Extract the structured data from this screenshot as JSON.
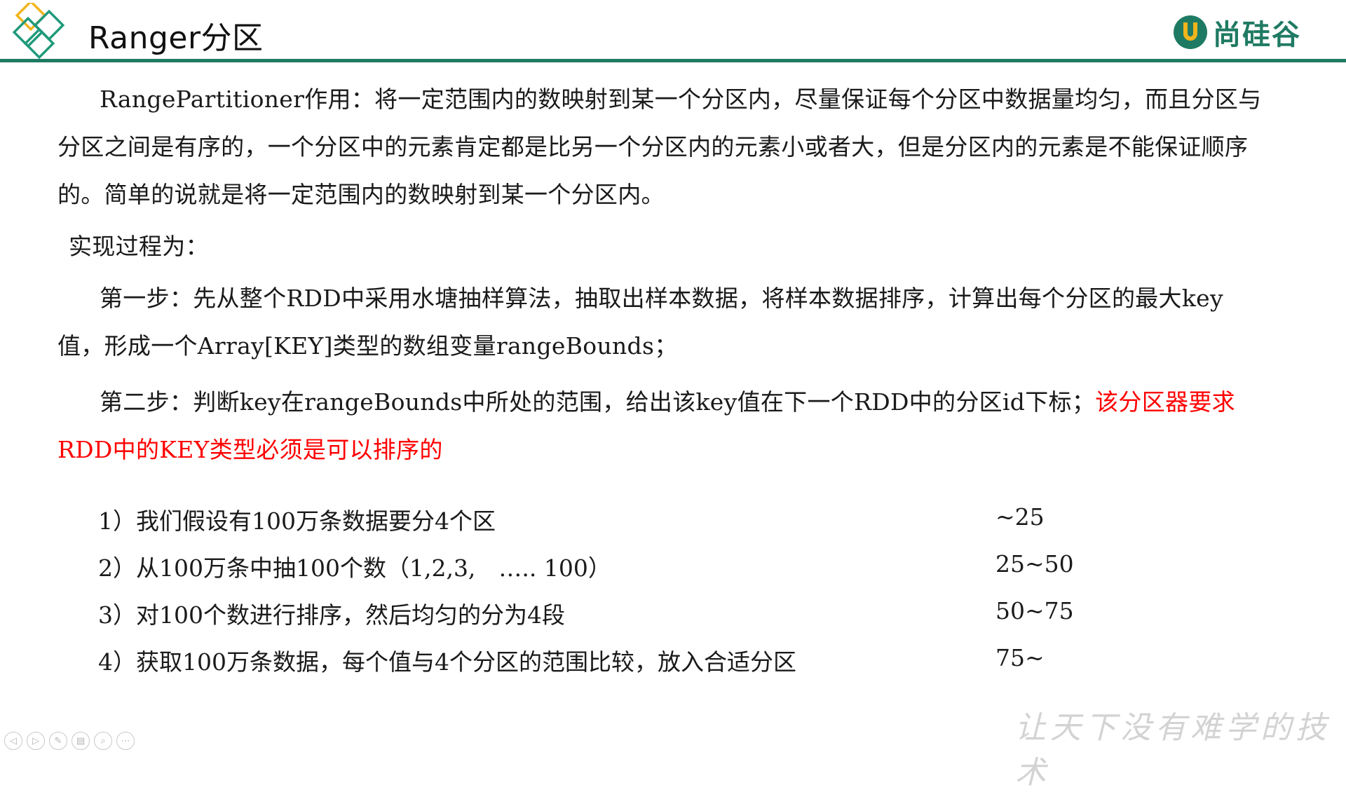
{
  "header": {
    "title": "Ranger分区",
    "brand_name": "尚硅谷",
    "accent_color": "#1f7a63"
  },
  "body": {
    "paragraph1": "RangePartitioner作用：将一定范围内的数映射到某一个分区内，尽量保证每个分区中数据量均匀，而且分区与分区之间是有序的，一个分区中的元素肯定都是比另一个分区内的元素小或者大，但是分区内的元素是不能保证顺序的。简单的说就是将一定范围内的数映射到某一个分区内。",
    "paragraph2": "实现过程为：",
    "step1": "第一步：先从整个RDD中采用水塘抽样算法，抽取出样本数据，将样本数据排序，计算出每个分区的最大key值，形成一个Array[KEY]类型的数组变量rangeBounds；",
    "step2_normal": "第二步：判断key在rangeBounds中所处的范围，给出该key值在下一个RDD中的分区id下标；",
    "step2_red": "该分区器要求RDD中的KEY类型必须是可以排序的",
    "highlight_color": "#ff0000"
  },
  "list": {
    "items": [
      "1）我们假设有100万条数据要分4个区",
      "2）从100万条中抽100个数（1,2,3,　….. 100）",
      "3）对100个数进行排序，然后均匀的分为4段",
      "4）获取100万条数据，每个值与4个分区的范围比较，放入合适分区"
    ],
    "ranges": [
      "~25",
      "25~50",
      "50~75",
      "75~"
    ]
  },
  "footer": {
    "slogan": "让天下没有难学的技术",
    "controls": [
      {
        "icon": "prev-icon",
        "glyph": "◁"
      },
      {
        "icon": "next-icon",
        "glyph": "▷"
      },
      {
        "icon": "pen-icon",
        "glyph": "✎"
      },
      {
        "icon": "slides-icon",
        "glyph": "▤"
      },
      {
        "icon": "zoom-icon",
        "glyph": "⌕"
      },
      {
        "icon": "more-icon",
        "glyph": "⋯"
      }
    ]
  }
}
